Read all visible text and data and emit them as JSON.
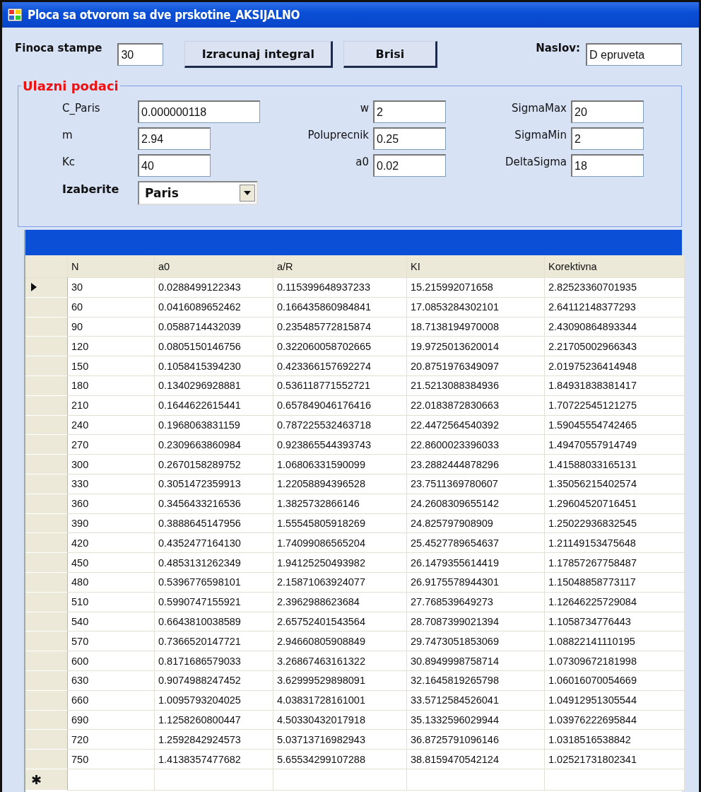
{
  "window": {
    "title": "Ploca sa otvorom sa dve prskotine_AKSIJALNO"
  },
  "toolbar": {
    "fineness_label": "Finoca stampe",
    "fineness_value": "30",
    "buttons": [
      "Izracunaj integral",
      "Brisi"
    ],
    "title_label": "Naslov:",
    "title_value": "D epruveta"
  },
  "input_group": {
    "legend": "Ulazni podaci",
    "fields": [
      {
        "kind": "text",
        "label": "C_Paris",
        "value": "0.000000118",
        "wide": true
      },
      {
        "kind": "text",
        "label": "w",
        "value": "2",
        "wide": false
      },
      {
        "kind": "text",
        "label": "SigmaMax",
        "value": "20",
        "wide": false
      },
      {
        "kind": "text",
        "label": "m",
        "value": "2.94",
        "wide": false
      },
      {
        "kind": "text",
        "label": "Poluprecnik",
        "value": "0.25",
        "wide": false
      },
      {
        "kind": "text",
        "label": "SigmaMin",
        "value": "2",
        "wide": false
      },
      {
        "kind": "text",
        "label": "Kc",
        "value": "40",
        "wide": false
      },
      {
        "kind": "text",
        "label": "a0",
        "value": "0.02",
        "wide": false
      },
      {
        "kind": "text",
        "label": "DeltaSigma",
        "value": "18",
        "wide": false
      },
      {
        "kind": "combo",
        "label": "Izaberite",
        "value": "Paris",
        "wide": true
      }
    ]
  },
  "table": {
    "columns": [
      "N",
      "a0",
      "a/R",
      "KI",
      "Korektivna"
    ],
    "rows": [
      {
        "current": true,
        "cells": [
          "30",
          "0.0288499122343",
          "0.115399648937233",
          "15.215992071658",
          "2.82523360701935"
        ]
      },
      {
        "current": false,
        "cells": [
          "60",
          "0.0416089652462",
          "0.166435860984841",
          "17.0853284302101",
          "2.64112148377293"
        ]
      },
      {
        "current": false,
        "cells": [
          "90",
          "0.0588714432039",
          "0.235485772815874",
          "18.7138194970008",
          "2.43090864893344"
        ]
      },
      {
        "current": false,
        "cells": [
          "120",
          "0.0805150146756",
          "0.322060058702665",
          "19.9725013620014",
          "2.21705002966343"
        ]
      },
      {
        "current": false,
        "cells": [
          "150",
          "0.1058415394230",
          "0.423366157692274",
          "20.8751976349097",
          "2.01975236414948"
        ]
      },
      {
        "current": false,
        "cells": [
          "180",
          "0.1340296928881",
          "0.536118771552721",
          "21.5213088384936",
          "1.84931838381417"
        ]
      },
      {
        "current": false,
        "cells": [
          "210",
          "0.1644622615441",
          "0.657849046176416",
          "22.0183872830663",
          "1.70722545121275"
        ]
      },
      {
        "current": false,
        "cells": [
          "240",
          "0.1968063831159",
          "0.787225532463718",
          "22.4472564540392",
          "1.59045554742465"
        ]
      },
      {
        "current": false,
        "cells": [
          "270",
          "0.2309663860984",
          "0.923865544393743",
          "22.8600023396033",
          "1.49470557914749"
        ]
      },
      {
        "current": false,
        "cells": [
          "300",
          "0.2670158289752",
          "1.06806331590099",
          "23.2882444878296",
          "1.41588033165131"
        ]
      },
      {
        "current": false,
        "cells": [
          "330",
          "0.3051472359913",
          "1.22058894396528",
          "23.7511369780607",
          "1.35056215402574"
        ]
      },
      {
        "current": false,
        "cells": [
          "360",
          "0.3456433216536",
          "1.3825732866146",
          "24.2608309655142",
          "1.29604520716451"
        ]
      },
      {
        "current": false,
        "cells": [
          "390",
          "0.3888645147956",
          "1.55545805918269",
          "24.825797908909",
          "1.25022936832545"
        ]
      },
      {
        "current": false,
        "cells": [
          "420",
          "0.4352477164130",
          "1.74099086565204",
          "25.4527789654637",
          "1.21149153475648"
        ]
      },
      {
        "current": false,
        "cells": [
          "450",
          "0.4853131262349",
          "1.94125250493982",
          "26.1479355614419",
          "1.17857267758487"
        ]
      },
      {
        "current": false,
        "cells": [
          "480",
          "0.5396776598101",
          "2.15871063924077",
          "26.9175578944301",
          "1.15048858773117"
        ]
      },
      {
        "current": false,
        "cells": [
          "510",
          "0.5990747155921",
          "2.3962988623684",
          "27.768539649273",
          "1.12646225729084"
        ]
      },
      {
        "current": false,
        "cells": [
          "540",
          "0.6643810038589",
          "2.65752401543564",
          "28.7087399021394",
          "1.1058734776443"
        ]
      },
      {
        "current": false,
        "cells": [
          "570",
          "0.7366520147721",
          "2.94660805908849",
          "29.7473051853069",
          "1.08822141110195"
        ]
      },
      {
        "current": false,
        "cells": [
          "600",
          "0.8171686579033",
          "3.26867463161322",
          "30.8949998758714",
          "1.07309672181998"
        ]
      },
      {
        "current": false,
        "cells": [
          "630",
          "0.9074988247452",
          "3.62999529898091",
          "32.1645819265798",
          "1.06016070054669"
        ]
      },
      {
        "current": false,
        "cells": [
          "660",
          "1.0095793204025",
          "4.03831728161001",
          "33.5712584526041",
          "1.04912951305544"
        ]
      },
      {
        "current": false,
        "cells": [
          "690",
          "1.1258260800447",
          "4.50330432017918",
          "35.1332596029944",
          "1.03976222695844"
        ]
      },
      {
        "current": false,
        "cells": [
          "720",
          "1.2592842924573",
          "5.03713716982943",
          "36.8725791096146",
          "1.0318516538842"
        ]
      },
      {
        "current": false,
        "cells": [
          "750",
          "1.4138357477682",
          "5.65534299107288",
          "38.8159470542124",
          "1.02521731802341"
        ]
      }
    ],
    "new_row_marker": "✱"
  }
}
